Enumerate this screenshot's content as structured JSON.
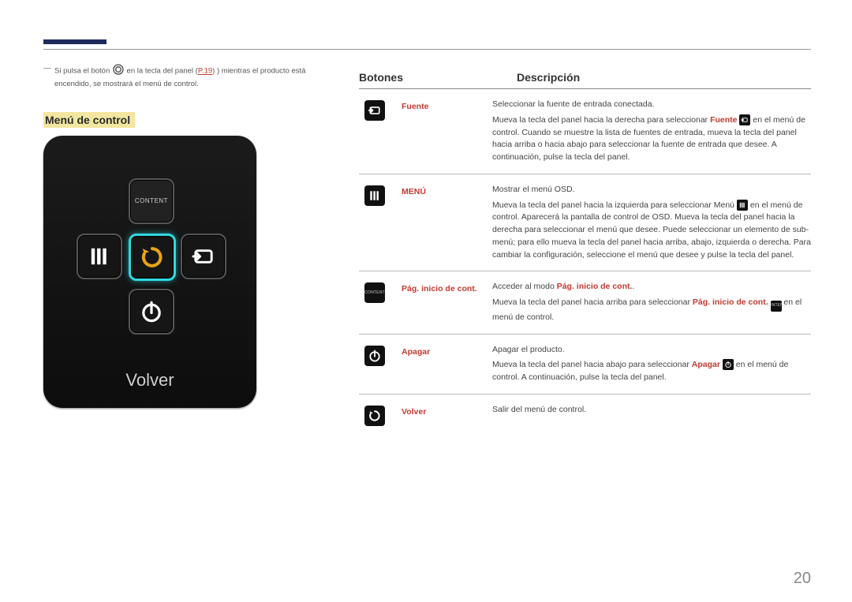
{
  "page_number": "20",
  "note": {
    "prefix": "Si pulsa el botón",
    "mid": "en la tecla del panel (",
    "pref": "P.19",
    "suffix": ") mientras el producto está encendido, se mostrará el menú de control."
  },
  "control_menu_title": "Menú de control",
  "remote": {
    "content_label": "CONTENT",
    "volver": "Volver"
  },
  "table": {
    "header_buttons": "Botones",
    "header_desc": "Descripción",
    "rows": [
      {
        "icon": "source",
        "label": "Fuente",
        "lead": "Seleccionar la fuente de entrada conectada.",
        "body_pre": "Mueva la tecla del panel hacia la derecha para seleccionar ",
        "body_hl": "Fuente",
        "body_post": " en el menú de control. Cuando se muestre la lista de fuentes de entrada, mueva la tecla del panel hacia arriba o hacia abajo para seleccionar la fuente de entrada que desee. A continuación, pulse la tecla del panel.",
        "inline_icon": "source"
      },
      {
        "icon": "menu",
        "label": "MENÚ",
        "lead": "Mostrar el menú OSD.",
        "body_pre": "Mueva la tecla del panel hacia la izquierda para seleccionar Menú ",
        "body_hl": "",
        "body_post": " en el menú de control. Aparecerá la pantalla de control de OSD. Mueva la tecla del panel hacia la derecha para seleccionar el menú que desee. Puede seleccionar un elemento de sub-menú; para ello mueva la tecla del panel hacia arriba, abajo, izquierda o derecha. Para cambiar la configuración, seleccione el menú que desee y pulse la tecla del panel.",
        "inline_icon": "menu"
      },
      {
        "icon": "content",
        "label": "Pág. inicio de cont.",
        "lead_pre": "Acceder al modo ",
        "lead_hl": "Pág. inicio de cont.",
        "lead_post": ".",
        "body_pre": "Mueva la tecla del panel hacia arriba para seleccionar ",
        "body_hl": "Pág. inicio de cont.",
        "body_post": " en el menú de control.",
        "inline_icon": "content"
      },
      {
        "icon": "power",
        "label": "Apagar",
        "lead": "Apagar el producto.",
        "body_pre": "Mueva la tecla del panel hacia abajo para seleccionar ",
        "body_hl": "Apagar",
        "body_post": " en el menú de control. A continuación, pulse la tecla del panel.",
        "inline_icon": "power"
      },
      {
        "icon": "return",
        "label": "Volver",
        "lead": "Salir del menú de control.",
        "body_pre": "",
        "body_hl": "",
        "body_post": "",
        "inline_icon": ""
      }
    ]
  }
}
